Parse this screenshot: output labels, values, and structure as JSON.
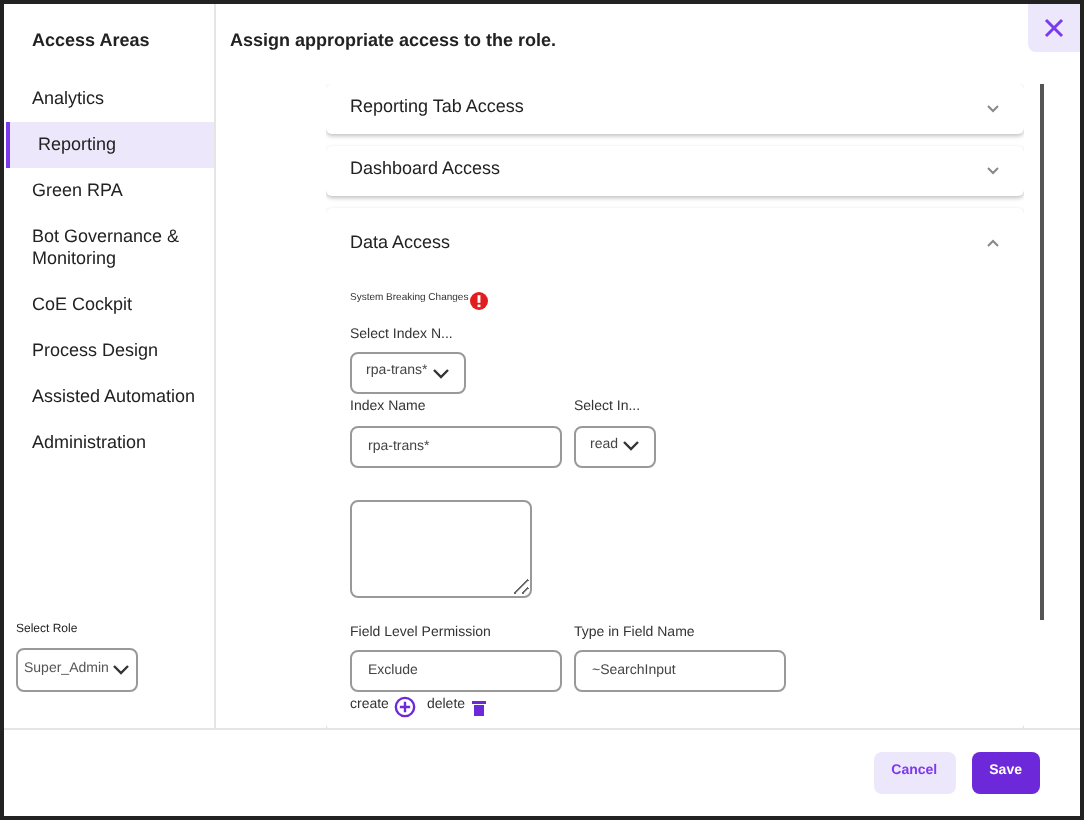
{
  "sidebar": {
    "title": "Access Areas",
    "items": [
      {
        "label": "Analytics",
        "selected": false
      },
      {
        "label": "Reporting",
        "selected": true
      },
      {
        "label": "Green RPA",
        "selected": false
      },
      {
        "label": "Bot Governance & Monitoring",
        "selected": false
      },
      {
        "label": "CoE Cockpit",
        "selected": false
      },
      {
        "label": "Process Design",
        "selected": false
      },
      {
        "label": "Assisted Automation",
        "selected": false
      },
      {
        "label": "Administration",
        "selected": false
      }
    ],
    "role": {
      "label": "Select Role",
      "value": "Super_Admin"
    }
  },
  "main": {
    "title": "Assign appropriate access to the role.",
    "sections": [
      {
        "title": "Reporting Tab Access",
        "expanded": false
      },
      {
        "title": "Dashboard Access",
        "expanded": false
      },
      {
        "title": "Data Access",
        "expanded": true
      }
    ],
    "data_access": {
      "warning": "System Breaking Changes",
      "index_select": {
        "label": "Select Index N...",
        "value": "rpa-trans*"
      },
      "index_name": {
        "label": "Index Name",
        "value": "rpa-trans*"
      },
      "permission_select": {
        "label": "Select In...",
        "value": "read"
      },
      "field_permission": {
        "label": "Field Level Permission",
        "value": "Exclude"
      },
      "field_name": {
        "label": "Type in Field Name",
        "value": "~SearchInput"
      },
      "create": "create",
      "delete": "delete"
    }
  },
  "footer": {
    "buttons": [
      {
        "label": "Cancel",
        "kind": "secondary"
      },
      {
        "label": "Save",
        "kind": "primary"
      }
    ]
  }
}
